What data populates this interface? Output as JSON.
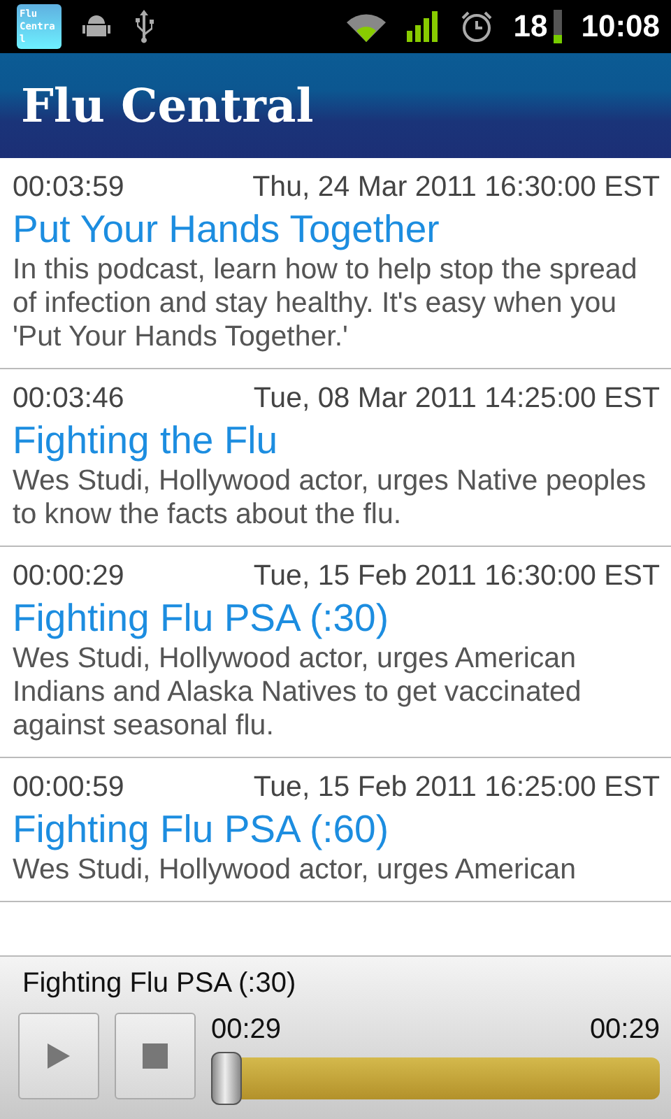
{
  "status_bar": {
    "app_icon_label": "Flu Central",
    "battery": "18",
    "time": "10:08"
  },
  "title": "Flu Central",
  "episodes": [
    {
      "duration": "00:03:59",
      "date": "Thu, 24 Mar 2011 16:30:00 EST",
      "title": "Put Your Hands Together",
      "description": "In this podcast, learn how to help stop the spread of infection and stay healthy. It's easy when you 'Put Your Hands Together.'"
    },
    {
      "duration": "00:03:46",
      "date": "Tue, 08 Mar 2011 14:25:00 EST",
      "title": "Fighting the Flu",
      "description": "Wes Studi, Hollywood actor, urges Native peoples to know the facts about the flu."
    },
    {
      "duration": "00:00:29",
      "date": "Tue, 15 Feb 2011 16:30:00 EST",
      "title": "Fighting Flu PSA (:30)",
      "description": "Wes Studi, Hollywood actor, urges American Indians and Alaska Natives to get vaccinated against seasonal flu."
    },
    {
      "duration": "00:00:59",
      "date": "Tue, 15 Feb 2011 16:25:00 EST",
      "title": "Fighting Flu PSA (:60)",
      "description": "Wes Studi, Hollywood actor, urges American"
    }
  ],
  "player": {
    "now_playing": "Fighting Flu PSA (:30)",
    "elapsed": "00:29",
    "total": "00:29",
    "level": 0
  }
}
